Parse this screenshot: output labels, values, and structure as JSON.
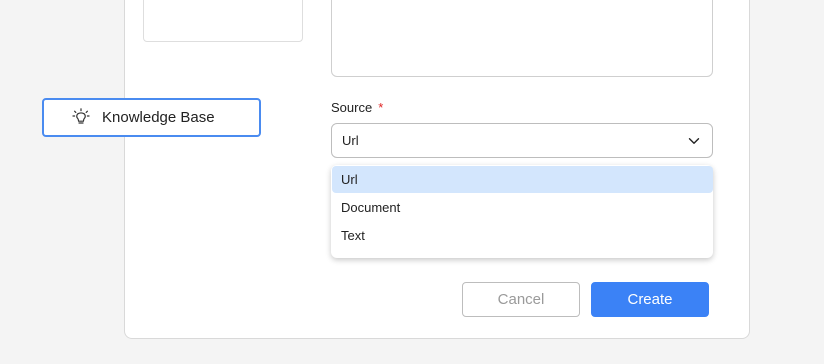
{
  "knowledge_chip": {
    "label": "Knowledge Base",
    "icon": "lightbulb-icon"
  },
  "form": {
    "description_value": "",
    "source": {
      "label": "Source",
      "required_mark": "*",
      "selected": "Url",
      "chevron_icon": "chevron-down-icon",
      "options": [
        "Url",
        "Document",
        "Text"
      ]
    }
  },
  "buttons": {
    "cancel": "Cancel",
    "create": "Create"
  },
  "colors": {
    "accent": "#3b82f6",
    "chip_border": "#4a8bf0",
    "selected_option_bg": "#d3e6fd",
    "required": "#e02424"
  }
}
